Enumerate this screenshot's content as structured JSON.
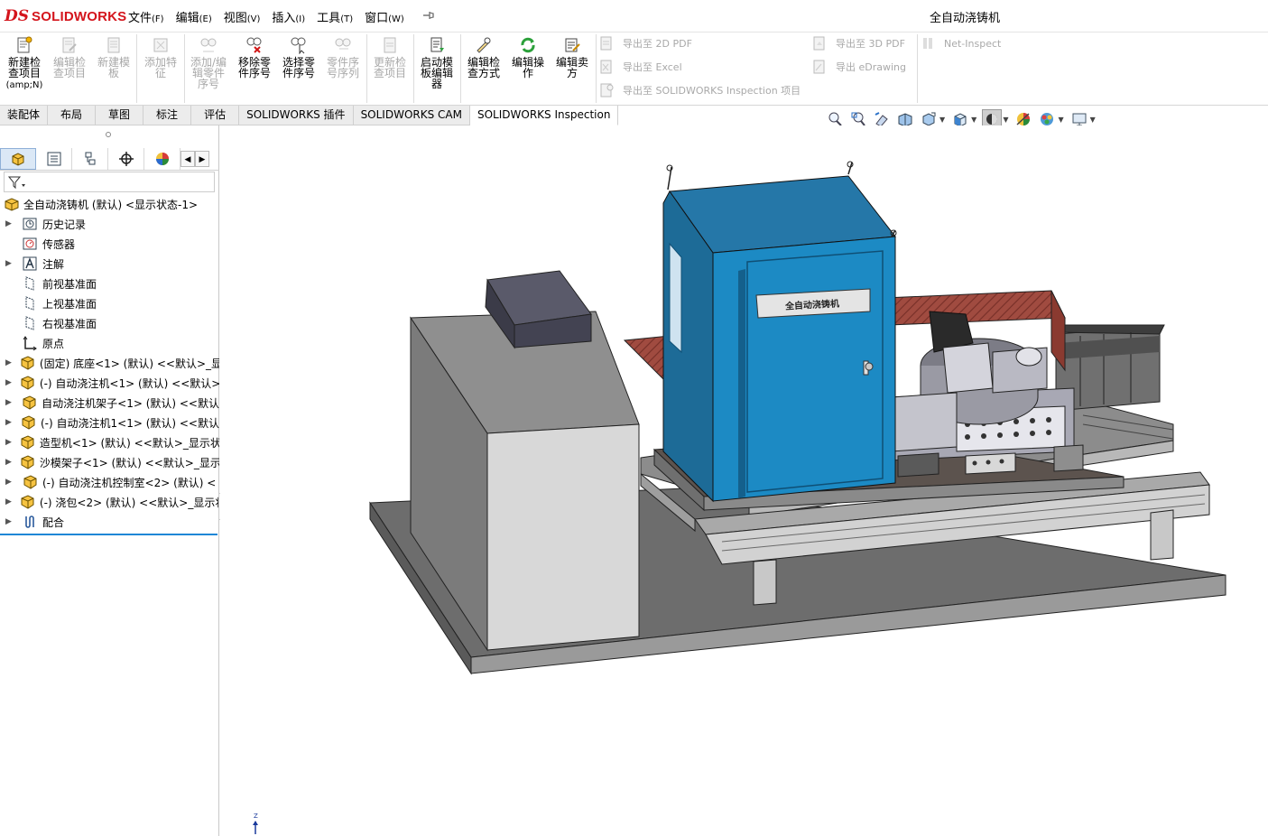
{
  "app": {
    "logo_ds": "DS",
    "logo_text": "SOLIDWORKS",
    "document_title": "全自动浇铸机",
    "brand_color": "#d4141c"
  },
  "menu": [
    {
      "label": "文件",
      "key": "(F)"
    },
    {
      "label": "编辑",
      "key": "(E)"
    },
    {
      "label": "视图",
      "key": "(V)"
    },
    {
      "label": "插入",
      "key": "(I)"
    },
    {
      "label": "工具",
      "key": "(T)"
    },
    {
      "label": "窗口",
      "key": "(W)"
    }
  ],
  "ribbon": {
    "new_inspection": {
      "line1": "新建检",
      "line2": "查项目",
      "line3": "(amp;N)"
    },
    "edit_inspection": {
      "line1": "编辑检",
      "line2": "查项目"
    },
    "new_template": {
      "line1": "新建模",
      "line2": "板"
    },
    "add_feature": {
      "line1": "添加特",
      "line2": "征"
    },
    "add_edit_balloon": {
      "line1": "添加/编",
      "line2": "辑零件",
      "line3": "序号"
    },
    "remove_balloon": {
      "line1": "移除零",
      "line2": "件序号"
    },
    "select_balloon": {
      "line1": "选择零",
      "line2": "件序号"
    },
    "balloon_sequence": {
      "line1": "零件序",
      "line2": "号序列"
    },
    "update_inspection": {
      "line1": "更新检",
      "line2": "查项目"
    },
    "launch_template_editor": {
      "line1": "启动模",
      "line2": "板编辑",
      "line3": "器"
    },
    "edit_inspection_method": {
      "line1": "编辑检",
      "line2": "查方式"
    },
    "edit_operation": {
      "line1": "编辑操",
      "line2": "作"
    },
    "edit_vendor": {
      "line1": "编辑卖",
      "line2": "方"
    },
    "export_2d_pdf": "导出至 2D PDF",
    "export_excel": "导出至 Excel",
    "export_inspection": "导出至 SOLIDWORKS Inspection 项目",
    "export_3d_pdf": "导出至 3D PDF",
    "export_edrawing": "导出 eDrawing",
    "net_inspect": "Net-Inspect"
  },
  "tabs": [
    {
      "label": "装配体",
      "active": false
    },
    {
      "label": "布局",
      "active": false
    },
    {
      "label": "草图",
      "active": false
    },
    {
      "label": "标注",
      "active": false
    },
    {
      "label": "评估",
      "active": false
    },
    {
      "label": "SOLIDWORKS 插件",
      "active": false
    },
    {
      "label": "SOLIDWORKS CAM",
      "active": false
    },
    {
      "label": "SOLIDWORKS Inspection",
      "active": true
    }
  ],
  "tree": {
    "root": "全自动浇铸机 (默认) <显示状态-1>",
    "items": [
      {
        "label": "历史记录",
        "icon": "history-icon",
        "expandable": true
      },
      {
        "label": "传感器",
        "icon": "sensor-icon",
        "expandable": false
      },
      {
        "label": "注解",
        "icon": "annotation-icon",
        "expandable": true
      },
      {
        "label": "前视基准面",
        "icon": "plane-icon",
        "expandable": false
      },
      {
        "label": "上视基准面",
        "icon": "plane-icon",
        "expandable": false
      },
      {
        "label": "右视基准面",
        "icon": "plane-icon",
        "expandable": false
      },
      {
        "label": "原点",
        "icon": "origin-icon",
        "expandable": false
      },
      {
        "label": "(固定) 底座<1> (默认) <<默认>_显",
        "icon": "part-icon",
        "expandable": true
      },
      {
        "label": "(-) 自动浇注机<1> (默认) <<默认>",
        "icon": "part-icon",
        "expandable": true
      },
      {
        "label": "自动浇注机架子<1> (默认) <<默认",
        "icon": "part-icon",
        "expandable": true
      },
      {
        "label": "(-) 自动浇注机1<1> (默认) <<默认",
        "icon": "part-icon",
        "expandable": true
      },
      {
        "label": "造型机<1> (默认) <<默认>_显示状",
        "icon": "part-icon",
        "expandable": true
      },
      {
        "label": "沙模架子<1> (默认) <<默认>_显示",
        "icon": "part-icon",
        "expandable": true
      },
      {
        "label": "(-) 自动浇注机控制室<2> (默认) <",
        "icon": "part-icon",
        "expandable": true
      },
      {
        "label": "(-) 浇包<2> (默认) <<默认>_显示状",
        "icon": "part-icon",
        "expandable": true
      },
      {
        "label": "配合",
        "icon": "mates-icon",
        "expandable": true
      }
    ]
  },
  "model": {
    "nameplate": "全自动浇铸机"
  },
  "triad": {
    "axis_label": "Z"
  }
}
